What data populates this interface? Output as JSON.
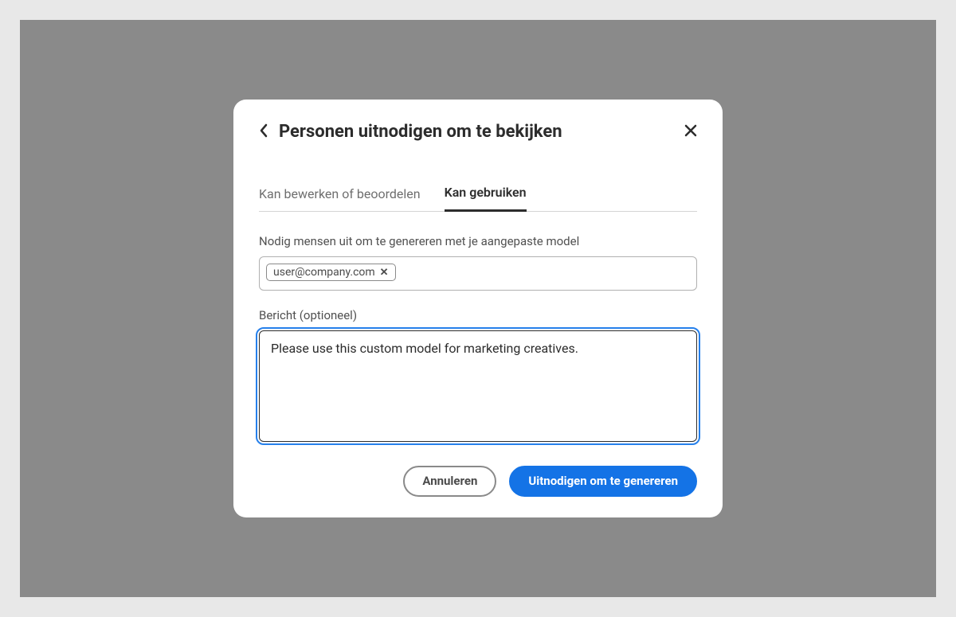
{
  "modal": {
    "title": "Personen uitnodigen om te bekijken"
  },
  "tabs": {
    "edit": "Kan bewerken of beoordelen",
    "use": "Kan gebruiken"
  },
  "invite": {
    "label": "Nodig mensen uit om te genereren met je aangepaste model",
    "email": "user@company.com"
  },
  "message": {
    "label": "Bericht (optioneel)",
    "value": "Please use this custom model for marketing creatives."
  },
  "buttons": {
    "cancel": "Annuleren",
    "invite": "Uitnodigen om te genereren"
  }
}
